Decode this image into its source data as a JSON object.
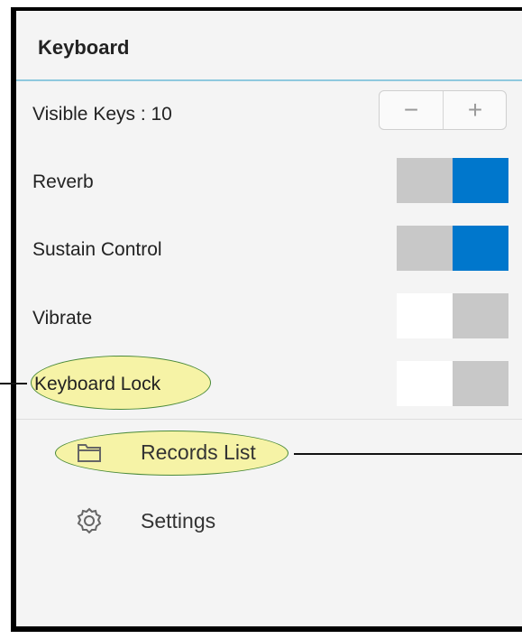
{
  "panel": {
    "title": "Keyboard"
  },
  "settings": {
    "visible_keys": {
      "label": "Visible Keys : 10",
      "minus": "−",
      "plus": "+"
    },
    "reverb": {
      "label": "Reverb",
      "state": "on"
    },
    "sustain": {
      "label": "Sustain Control",
      "state": "on"
    },
    "vibrate": {
      "label": "Vibrate",
      "state": "off"
    },
    "lock": {
      "label": "Keyboard Lock",
      "state": "off"
    }
  },
  "menu": {
    "records": {
      "label": "Records List",
      "icon": "folder-icon"
    },
    "settings": {
      "label": "Settings",
      "icon": "gear-icon"
    }
  },
  "colors": {
    "toggle_on": "#0077cc",
    "toggle_off": "#c8c8c8",
    "highlight": "#f6f3a6"
  }
}
